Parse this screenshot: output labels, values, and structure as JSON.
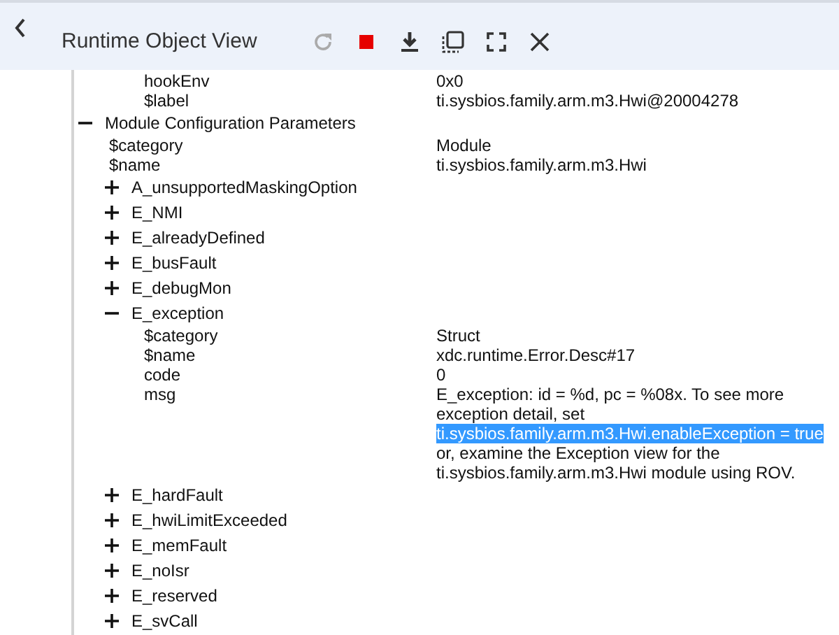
{
  "window": {
    "title": "Runtime Object View"
  },
  "tree": [
    {
      "children": [
        {
          "children": [
            {
              "kind": "property",
              "label": "hookEnv",
              "value": [
                {
                  "text": "0x0",
                  "selected": false
                }
              ]
            },
            {
              "kind": "property",
              "label": "$label",
              "value": [
                {
                  "text": "ti.sysbios.family.arm.m3.Hwi@20004278",
                  "selected": false
                }
              ]
            }
          ]
        }
      ]
    },
    {
      "kind": "node",
      "label": "Module Configuration Parameters",
      "expanded": true,
      "children": [
        {
          "kind": "property",
          "label": "$category",
          "value": [
            {
              "text": "Module",
              "selected": false
            }
          ]
        },
        {
          "kind": "property",
          "label": "$name",
          "value": [
            {
              "text": "ti.sysbios.family.arm.m3.Hwi",
              "selected": false
            }
          ]
        },
        {
          "kind": "node",
          "label": "A_unsupportedMaskingOption",
          "expanded": false
        },
        {
          "kind": "node",
          "label": "E_NMI",
          "expanded": false
        },
        {
          "kind": "node",
          "label": "E_alreadyDefined",
          "expanded": false
        },
        {
          "kind": "node",
          "label": "E_busFault",
          "expanded": false
        },
        {
          "kind": "node",
          "label": "E_debugMon",
          "expanded": false
        },
        {
          "kind": "node",
          "label": "E_exception",
          "expanded": true,
          "children": [
            {
              "kind": "property",
              "label": "$category",
              "value": [
                {
                  "text": "Struct",
                  "selected": false
                }
              ]
            },
            {
              "kind": "property",
              "label": "$name",
              "value": [
                {
                  "text": "xdc.runtime.Error.Desc#17",
                  "selected": false
                }
              ]
            },
            {
              "kind": "property",
              "label": "code",
              "value": [
                {
                  "text": "0",
                  "selected": false
                }
              ]
            },
            {
              "kind": "property",
              "label": "msg",
              "value": [
                {
                  "text": "E_exception: id = %d, pc = %08x. To see more exception detail, set",
                  "selected": false
                },
                {
                  "text": "ti.sysbios.family.arm.m3.Hwi.enableException = true",
                  "selected": true
                },
                {
                  "text": "or, examine the Exception view for the ti.sysbios.family.arm.m3.Hwi module using ROV.",
                  "selected": false
                }
              ]
            }
          ]
        },
        {
          "kind": "node",
          "label": "E_hardFault",
          "expanded": false
        },
        {
          "kind": "node",
          "label": "E_hwiLimitExceeded",
          "expanded": false
        },
        {
          "kind": "node",
          "label": "E_memFault",
          "expanded": false
        },
        {
          "kind": "node",
          "label": "E_noIsr",
          "expanded": false
        },
        {
          "kind": "node",
          "label": "E_reserved",
          "expanded": false
        },
        {
          "kind": "node",
          "label": "E_svCall",
          "expanded": false
        }
      ]
    }
  ]
}
